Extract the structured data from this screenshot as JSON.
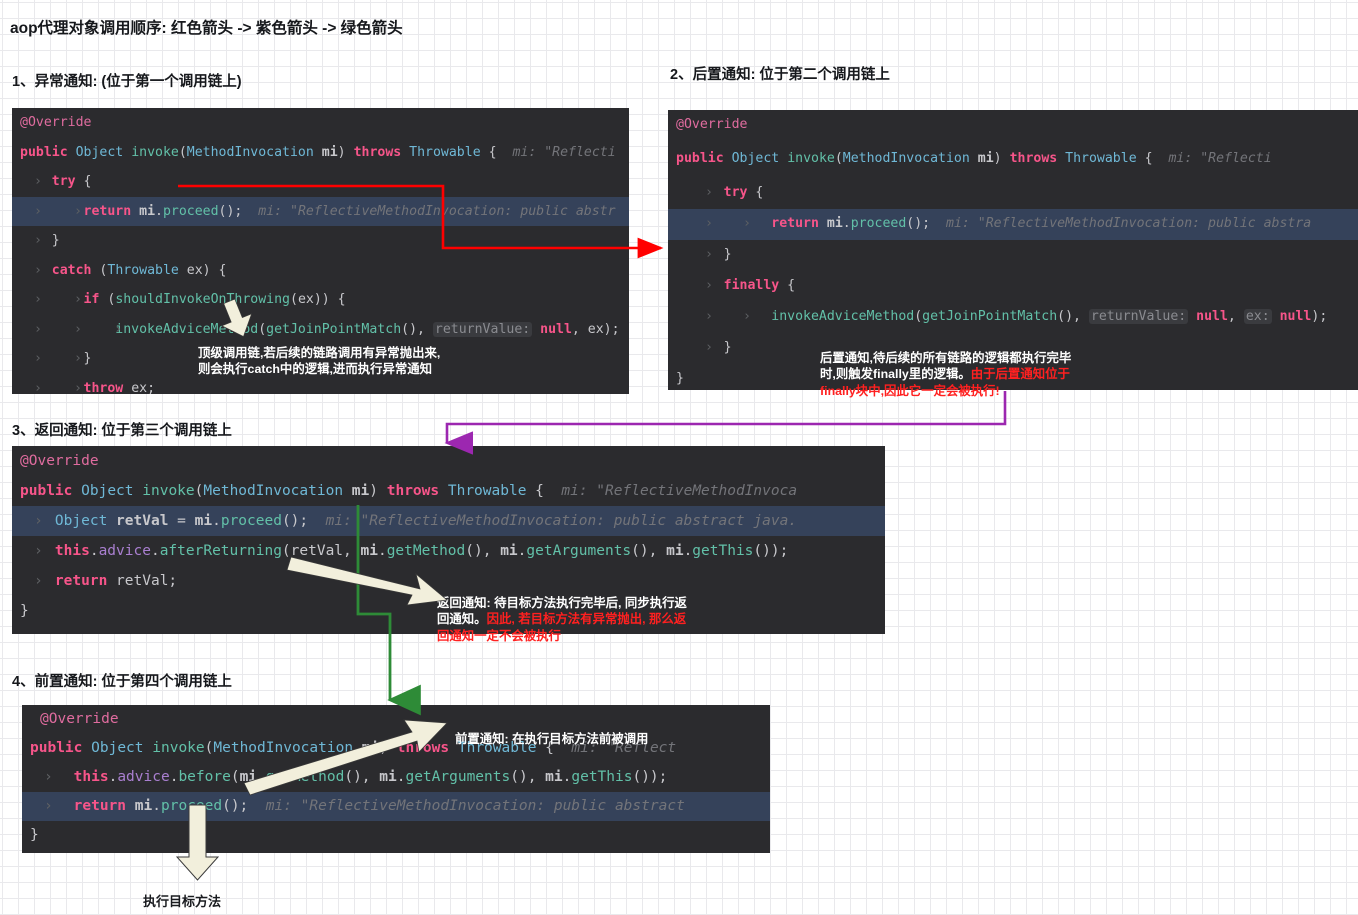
{
  "title": "aop代理对象调用顺序: 红色箭头 -> 紫色箭头 -> 绿色箭头",
  "colors": {
    "red_arrow": "#ff0000",
    "purple_arrow": "#9c27b0",
    "green_arrow": "#2e8b37",
    "white_arrow": "#f2efdc",
    "code_bg": "#2b2b2e",
    "highlight_line": "#35425a",
    "red_text": "#ff2020"
  },
  "sections": [
    {
      "label": "1、异常通知:  (位于第一个调用链上)",
      "code_lines": [
        "@Override",
        "public Object invoke(MethodInvocation mi) throws Throwable {   mi: \"Reflecti",
        "    try {",
        "        return mi.proceed();   mi: \"ReflectiveMethodInvocation: public abstr",
        "    }",
        "    catch (Throwable ex) {",
        "        if (shouldInvokeOnThrowing(ex)) {",
        "            invokeAdviceMethod(getJoinPointMatch(),  returnValue: null, ex);",
        "        }",
        "        throw ex;",
        "    }",
        "}"
      ],
      "highlight_line_index": 3,
      "annotation": {
        "text": "顶级调用链,若后续的链路调用有异常抛出来,\n则会执行catch中的逻辑,进而执行异常通知",
        "red_part": ""
      }
    },
    {
      "label": "2、后置通知: 位于第二个调用链上",
      "code_lines": [
        "@Override",
        "public Object invoke(MethodInvocation mi) throws Throwable {   mi: \"Reflecti",
        "    try {",
        "        return mi.proceed();   mi: \"ReflectiveMethodInvocation: public abstra",
        "    }",
        "    finally {",
        "        invokeAdviceMethod(getJoinPointMatch(),  returnValue: null,  ex: null);",
        "    }",
        "}"
      ],
      "highlight_line_index": 3,
      "annotation": {
        "text": "后置通知,待后续的所有链路的逻辑都执行完毕\n时,则触发finally里的逻辑。",
        "red_part": "由于后置通知位于\nfinally块中,因此它一定会被执行!"
      }
    },
    {
      "label": "3、返回通知: 位于第三个调用链上",
      "code_lines": [
        "@Override",
        "public Object invoke(MethodInvocation mi) throws Throwable {   mi: \"ReflectiveMethodInvoca",
        "    Object retVal = mi.proceed();   mi: \"ReflectiveMethodInvocation: public abstract java.",
        "    this.advice.afterReturning(retVal, mi.getMethod(), mi.getArguments(), mi.getThis());",
        "    return retVal;",
        "}"
      ],
      "highlight_line_index": 2,
      "annotation": {
        "text": "返回通知: 待目标方法执行完毕后, 同步执行返\n回通知。",
        "red_part": "因此, 若目标方法有异常抛出, 那么返\n回通知一定不会被执行"
      }
    },
    {
      "label": "4、前置通知: 位于第四个调用链上",
      "code_lines": [
        "@Override",
        "public Object invoke(MethodInvocation mi) throws Throwable {   mi: \"Reflect",
        "    this.advice.before(mi.getMethod(), mi.getArguments(), mi.getThis());",
        "    return mi.proceed();   mi: \"ReflectiveMethodInvocation: public abstract",
        "}"
      ],
      "highlight_line_index": 3,
      "annotation": {
        "text": "前置通知: 在执行目标方法前被调用",
        "red_part": ""
      }
    }
  ],
  "footer_label": "执行目标方法"
}
